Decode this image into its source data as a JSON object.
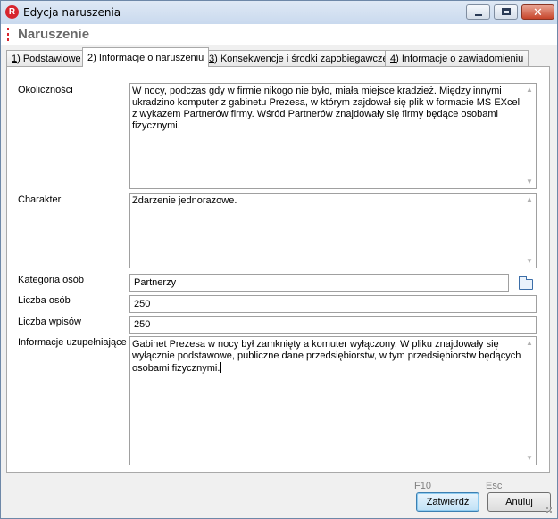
{
  "window": {
    "title": "Edycja naruszenia",
    "icon_letter": "R",
    "close_glyph": "✕"
  },
  "header": {
    "title": "Naruszenie"
  },
  "tabs": [
    {
      "key": "1",
      "label": ") Podstawiowe",
      "active": false
    },
    {
      "key": "2",
      "label": ") Informacje o naruszeniu",
      "active": true
    },
    {
      "key": "3",
      "label": ") Konsekwencje i środki zapobiegawcze",
      "active": false
    },
    {
      "key": "4",
      "label": ") Informacje o zawiadomieniu",
      "active": false
    }
  ],
  "form": {
    "okolicznosci": {
      "label": "Okoliczności",
      "value": "W nocy, podczas gdy w firmie nikogo nie było, miała miejsce kradzież. Między innymi ukradzino komputer z gabinetu Prezesa, w którym zajdował się plik w formacie MS EXcel z wykazem Partnerów firmy. Wśród Partnerów znajdowały się firmy będące osobami fizycznymi."
    },
    "charakter": {
      "label": "Charakter",
      "value": "Zdarzenie jednorazowe."
    },
    "kategoria_osob": {
      "label": "Kategoria osób",
      "value": "Partnerzy"
    },
    "liczba_osob": {
      "label": "Liczba osób",
      "value": "250"
    },
    "liczba_wpisow": {
      "label": "Liczba wpisów",
      "value": "250"
    },
    "informacje_uzupelniajace": {
      "label": "Informacje uzupełniające",
      "value": "Gabinet Prezesa w nocy był zamknięty a komuter wyłączony. W pliku znajdowały się wyłącznie podstawowe, publiczne dane przedsiębiorstw, w tym przedsiębiorstw będących osobami fizycznymi."
    }
  },
  "footer": {
    "confirm_shortcut": "F10",
    "confirm_label": "Zatwierdź",
    "cancel_shortcut": "Esc",
    "cancel_label": "Anuluj"
  },
  "icons": {
    "app": "app-logo-icon",
    "folder": "folder-icon",
    "scroll_up": "▲",
    "scroll_down": "▼"
  },
  "colors": {
    "brand_red": "#d7262f",
    "default_button_border": "#3c7fb1"
  }
}
